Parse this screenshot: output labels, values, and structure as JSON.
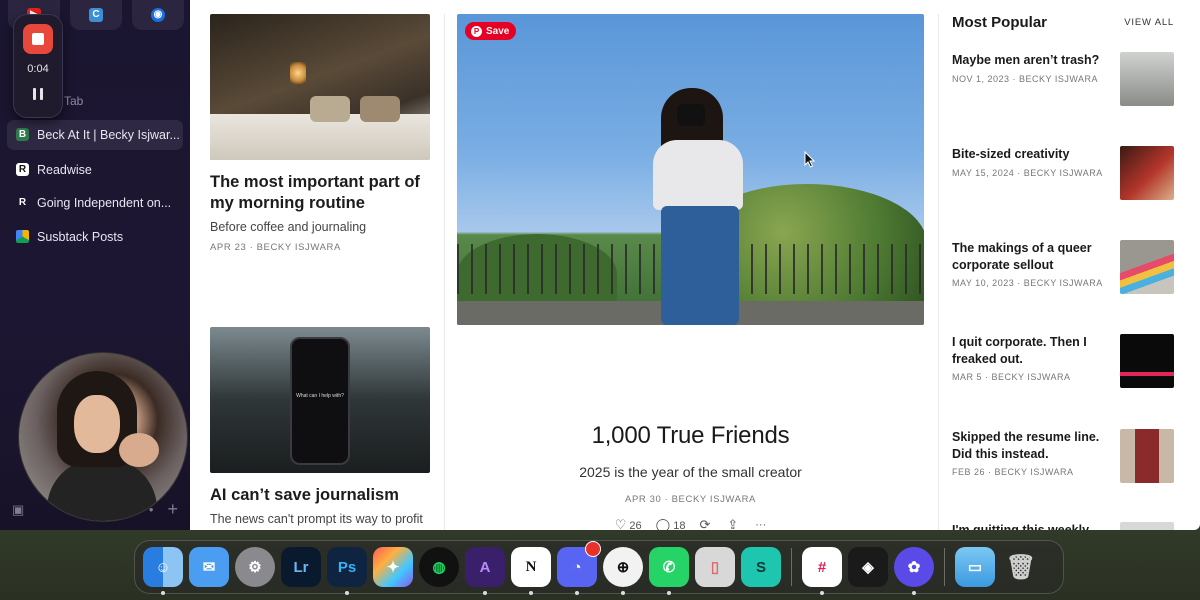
{
  "sidebar": {
    "top_tiles": [
      {
        "icon": "youtube-icon",
        "color": "#e62117",
        "glyph": "▶"
      },
      {
        "icon": "c-app-icon",
        "color": "#3a8fd8",
        "glyph": "C"
      },
      {
        "icon": "blue-app-icon",
        "color": "#1a6fe0",
        "glyph": "◉"
      }
    ],
    "recorder": {
      "time": "0:04"
    },
    "new_tab_label": "Tab",
    "tabs": [
      {
        "label": "Beck At It | Becky Isjwar...",
        "favicon": "B",
        "active": true
      },
      {
        "label": "Readwise",
        "favicon": "R"
      },
      {
        "label": "Going Independent on...",
        "favicon": "R"
      },
      {
        "label": "Susbtack Posts",
        "favicon": "drive"
      }
    ]
  },
  "main": {
    "left_posts": [
      {
        "title": "The most important part of my morning routine",
        "subtitle": "Before coffee and journaling",
        "meta": "APR 23 · BECKY ISJWARA"
      },
      {
        "title": "AI can’t save journalism",
        "subtitle": "The news can't prompt its way to profit",
        "meta": "",
        "image_text": "What can I help with?"
      }
    ],
    "featured": {
      "save_label": "Save",
      "title": "1,000 True Friends",
      "subtitle": "2025 is the year of the small creator",
      "meta": "APR 30 · BECKY ISJWARA",
      "likes": "26",
      "comments": "18",
      "more": "···"
    },
    "popular": {
      "heading": "Most Popular",
      "view_all": "VIEW ALL",
      "items": [
        {
          "title": "Maybe men aren’t trash?",
          "meta": "NOV 1, 2023 · BECKY ISJWARA",
          "color": "#9a9c98"
        },
        {
          "title": "Bite-sized creativity",
          "meta": "MAY 15, 2024 · BECKY ISJWARA",
          "color": "#7a2a22"
        },
        {
          "title": "The makings of a queer corporate sellout",
          "meta": "MAY 10, 2023 · BECKY ISJWARA",
          "color": "#b8b4ae"
        },
        {
          "title": "I quit corporate. Then I freaked out.",
          "meta": "MAR 5 · BECKY ISJWARA",
          "color": "#141414"
        },
        {
          "title": "Skipped the resume line. Did this instead.",
          "meta": "FEB 26 · BECKY ISJWARA",
          "color": "#8a4a3a"
        },
        {
          "title": "I'm quitting this weekly",
          "meta": "",
          "color": "#c8c8c8"
        }
      ]
    }
  },
  "dock": {
    "apps": [
      {
        "name": "finder-icon",
        "color": "#3d8ef0",
        "glyph": "☺"
      },
      {
        "name": "mail-icon",
        "color": "#4a9df0",
        "glyph": "✉"
      },
      {
        "name": "system-settings-icon",
        "color": "#8a8a8e",
        "glyph": "⚙"
      },
      {
        "name": "lightroom-icon",
        "color": "#0a1a2e",
        "glyph": "Lr"
      },
      {
        "name": "photoshop-icon",
        "color": "#0f2440",
        "glyph": "Ps"
      },
      {
        "name": "final-cut-icon",
        "color": "#222",
        "glyph": "✦"
      },
      {
        "name": "spotify-icon",
        "color": "#111",
        "glyph": "◍"
      },
      {
        "name": "affinity-icon",
        "color": "#3a1f6a",
        "glyph": "A"
      },
      {
        "name": "notion-icon",
        "color": "#ffffff",
        "glyph": "N"
      },
      {
        "name": "discord-icon",
        "color": "#5865f2",
        "glyph": "◔"
      },
      {
        "name": "safari-icon",
        "color": "#f2f2f2",
        "glyph": "⊕"
      },
      {
        "name": "whatsapp-icon",
        "color": "#25d366",
        "glyph": "✆"
      },
      {
        "name": "iphone-mirroring-icon",
        "color": "#d8d8d8",
        "glyph": "▯"
      },
      {
        "name": "surfshark-icon",
        "color": "#1ec6b0",
        "glyph": "S"
      },
      {
        "name": "slack-icon",
        "color": "#ffffff",
        "glyph": "#"
      },
      {
        "name": "cube-app-icon",
        "color": "#1a1a1a",
        "glyph": "◈"
      },
      {
        "name": "flower-app-icon",
        "color": "#5a4ae8",
        "glyph": "✿"
      },
      {
        "name": "folder-icon",
        "color": "#5cb8f0",
        "glyph": "▭"
      },
      {
        "name": "trash-icon",
        "color": "#9a9a9a",
        "glyph": "🗑"
      }
    ]
  }
}
